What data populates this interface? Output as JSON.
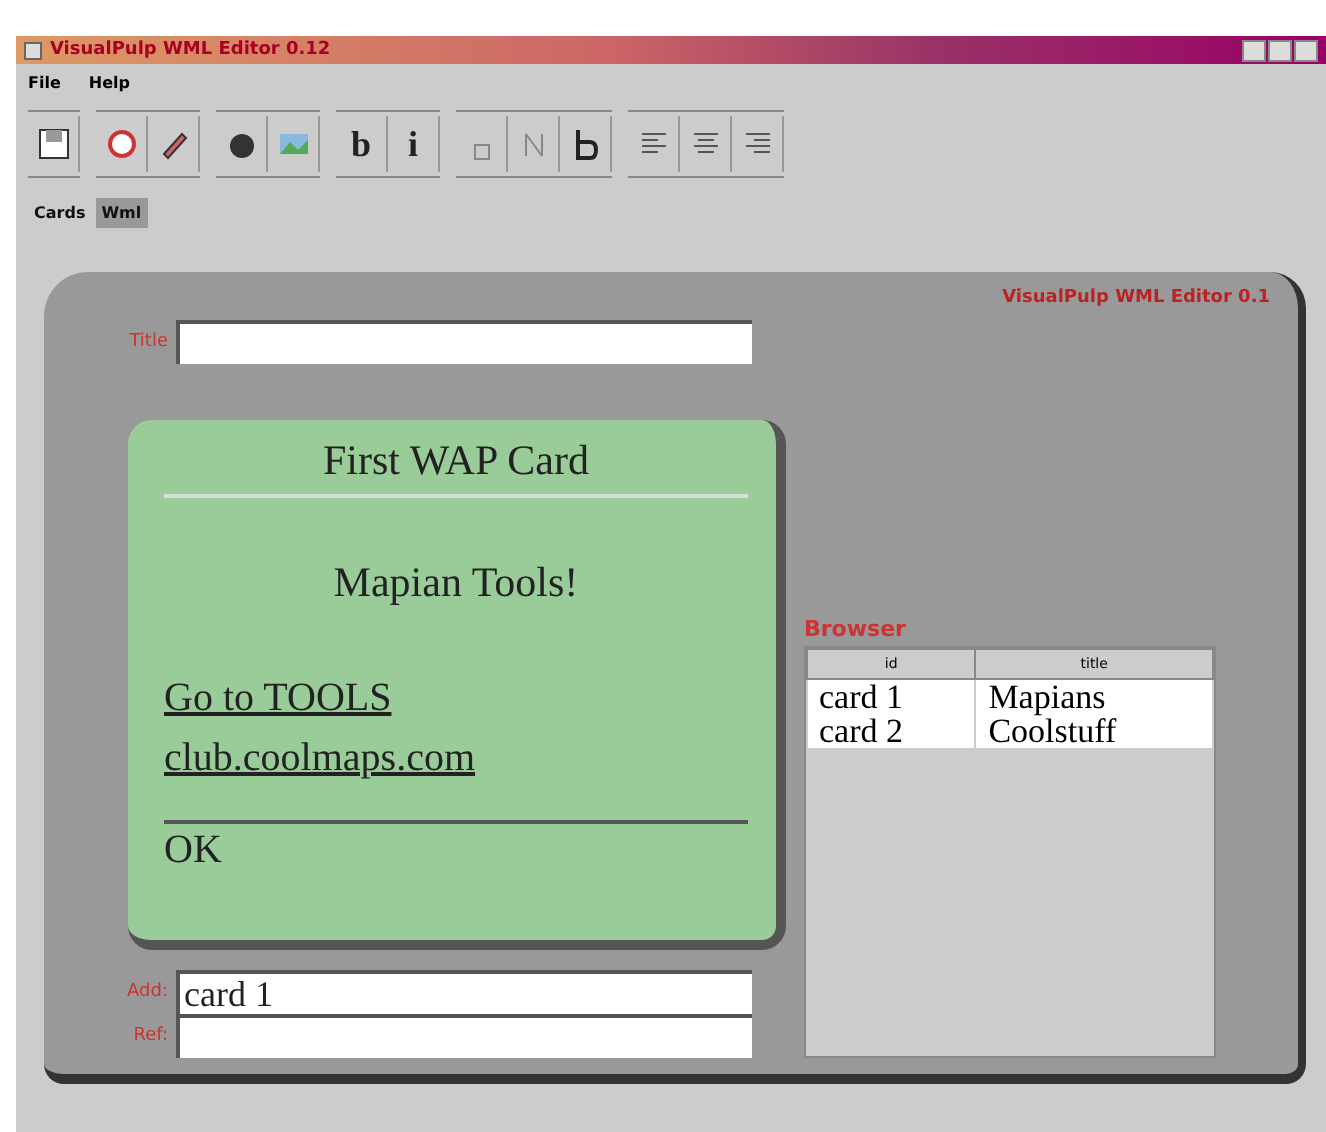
{
  "window": {
    "title": "VisualPulp WML Editor 0.12"
  },
  "menu": [
    "File",
    "Help"
  ],
  "toolbar": [
    [
      {
        "kind": "icon"
      }
    ],
    [
      {
        "kind": "icon"
      },
      {
        "kind": "icon"
      }
    ],
    [
      {
        "kind": "icon"
      },
      {
        "kind": "icon"
      }
    ],
    [
      {
        "kind": "text",
        "label": "b"
      },
      {
        "kind": "text",
        "label": "i"
      }
    ],
    [
      {
        "kind": "icon"
      },
      {
        "kind": "icon"
      },
      {
        "kind": "icon"
      }
    ],
    [
      {
        "kind": "icon"
      },
      {
        "kind": "icon"
      },
      {
        "kind": "icon"
      }
    ]
  ],
  "tabs": [
    {
      "label": "Cards",
      "selected": false
    },
    {
      "label": "Wml",
      "selected": true
    }
  ],
  "panel": {
    "heading": "VisualPulp WML Editor 0.1",
    "title_field": {
      "label": "Title"
    },
    "card": {
      "title": "First WAP Card",
      "body": "Mapian Tools!",
      "links": [
        "Go to TOOLS",
        "club.coolmaps.com"
      ],
      "softkey": "OK"
    },
    "fields": [
      {
        "label": "Add:",
        "value": "card 1"
      },
      {
        "label": "Ref:"
      }
    ],
    "table": {
      "title": "Browser",
      "columns": [
        "id",
        "title"
      ],
      "rows": [
        [
          "card 1",
          "Mapians"
        ],
        [
          "card 2",
          "Coolstuff"
        ]
      ]
    }
  }
}
